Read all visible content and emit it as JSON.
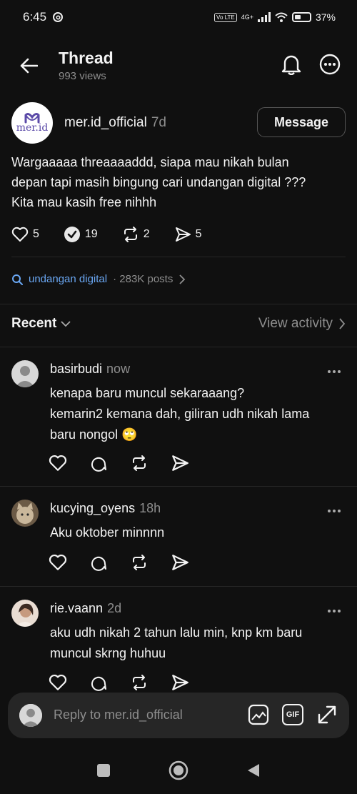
{
  "status": {
    "time": "6:45",
    "network": "4G+",
    "volte": "Vo LTE",
    "battery": "37%"
  },
  "header": {
    "title": "Thread",
    "views": "993 views"
  },
  "post": {
    "avatar_text": "mer.id",
    "username": "mer.id_official",
    "time": "7d",
    "message_button": "Message",
    "text": "Wargaaaaa threaaaaddd, siapa mau nikah bulan depan tapi masih bingung cari undangan digital ??? Kita mau kasih free nihhh",
    "likes": "5",
    "reposts_verified": "19",
    "reposts": "2",
    "shares": "5"
  },
  "topic": {
    "tag": "undangan digital",
    "count": "· 283K posts"
  },
  "sort": {
    "label": "Recent",
    "view_activity": "View activity"
  },
  "replies": [
    {
      "username": "basirbudi",
      "time": "now",
      "text_lines": [
        "kenapa baru muncul sekaraaang?",
        "kemarin2 kemana dah, giliran udh nikah lama",
        "baru nongol 🙄"
      ]
    },
    {
      "username": "kucying_oyens",
      "time": "18h",
      "text_lines": [
        "Aku oktober minnnn"
      ]
    },
    {
      "username": "rie.vaann",
      "time": "2d",
      "text_lines": [
        "aku udh nikah 2 tahun lalu min, knp km baru",
        "muncul skrng huhuu"
      ]
    }
  ],
  "composer": {
    "placeholder": "Reply to mer.id_official",
    "gif_label": "GIF"
  },
  "colors": {
    "background": "#101010",
    "link": "#6aa7f3",
    "muted": "#8e8e8e",
    "logo": "#5b4aa8"
  }
}
